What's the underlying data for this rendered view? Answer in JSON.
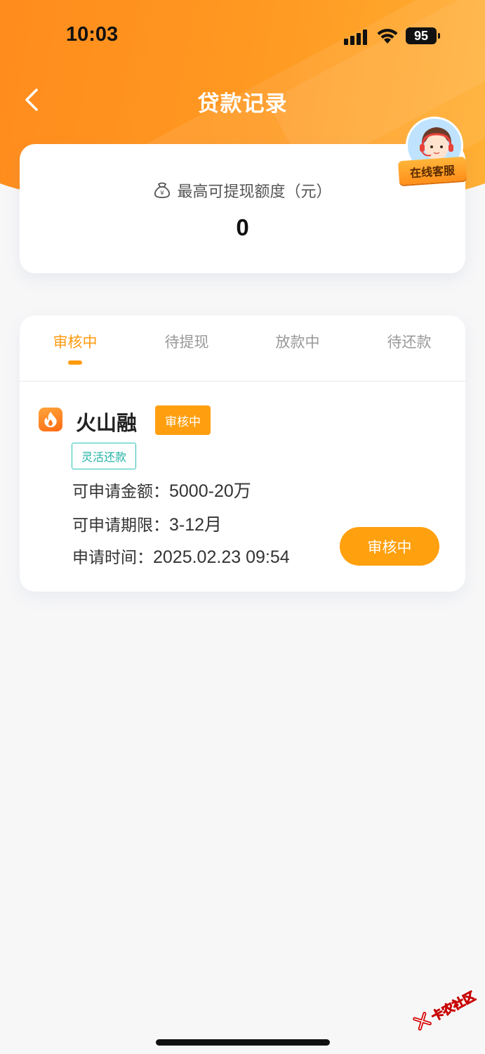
{
  "status_bar": {
    "time": "10:03",
    "battery": "95"
  },
  "nav": {
    "title": "贷款记录",
    "back_icon": "chevron-left-icon"
  },
  "customer_service": {
    "label": "在线客服"
  },
  "quota": {
    "label": "最高可提现额度（元）",
    "value": "0",
    "icon": "money-bag-icon"
  },
  "tabs": [
    {
      "label": "审核中",
      "active": true
    },
    {
      "label": "待提现",
      "active": false
    },
    {
      "label": "放款中",
      "active": false
    },
    {
      "label": "待还款",
      "active": false
    }
  ],
  "loan": {
    "name": "火山融",
    "status_tag": "审核中",
    "feature_tag": "灵活还款",
    "amount_label": "可申请金额：",
    "amount_value": "5000-20万",
    "term_label": "可申请期限：",
    "term_value": "3-12月",
    "time_label": "申请时间：",
    "time_value": "2025.02.23 09:54",
    "action_label": "审核中"
  },
  "watermark": {
    "text": "卡农社区"
  },
  "colors": {
    "accent": "#ff9a0e",
    "tag_teal": "#29c3b4"
  }
}
